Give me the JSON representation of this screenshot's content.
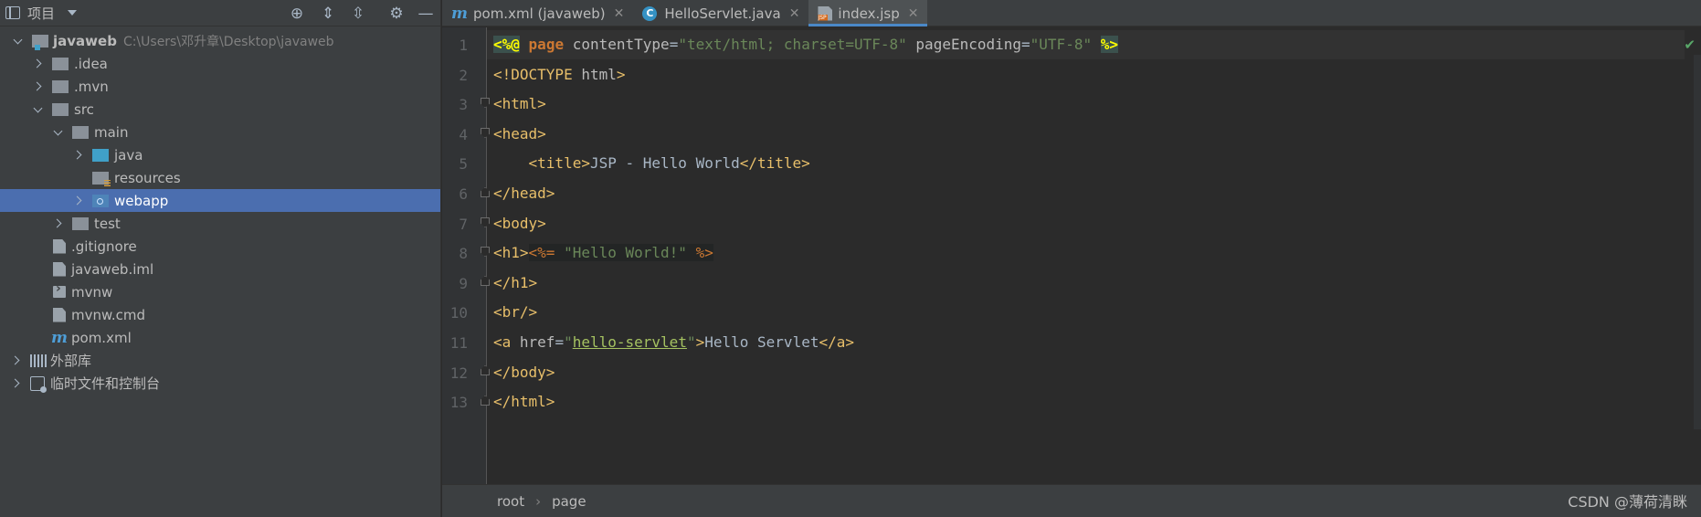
{
  "panel": {
    "title": "项目"
  },
  "tree": {
    "project_name": "javaweb",
    "project_path": "C:\\Users\\邓升章\\Desktop\\javaweb",
    "idea": ".idea",
    "mvn": ".mvn",
    "src": "src",
    "main": "main",
    "java": "java",
    "resources": "resources",
    "webapp": "webapp",
    "test": "test",
    "gitignore": ".gitignore",
    "iml": "javaweb.iml",
    "mvnw": "mvnw",
    "mvnw_cmd": "mvnw.cmd",
    "pom": "pom.xml",
    "external_libs": "外部库",
    "scratches": "临时文件和控制台"
  },
  "tabs": [
    {
      "label": "pom.xml (javaweb)",
      "icon": "maven-icon"
    },
    {
      "label": "HelloServlet.java",
      "icon": "java-class-icon"
    },
    {
      "label": "index.jsp",
      "icon": "jsp-file-icon",
      "active": true
    }
  ],
  "code_lines": [
    "<%@ page contentType=\"text/html; charset=UTF-8\" pageEncoding=\"UTF-8\" %>",
    "<!DOCTYPE html>",
    "<html>",
    "<head>",
    "    <title>JSP - Hello World</title>",
    "</head>",
    "<body>",
    "<h1><%= \"Hello World!\" %>",
    "</h1>",
    "<br/>",
    "<a href=\"hello-servlet\">Hello Servlet</a>",
    "</body>",
    "</html>"
  ],
  "line_numbers": [
    "1",
    "2",
    "3",
    "4",
    "5",
    "6",
    "7",
    "8",
    "9",
    "10",
    "11",
    "12",
    "13"
  ],
  "breadcrumbs": [
    "root",
    "page"
  ],
  "watermark": "CSDN @薄荷清眯",
  "colors": {
    "selection": "#4b6eaf",
    "tag": "#e8bf6a",
    "string": "#6a8759",
    "keyword": "#cc7832"
  }
}
